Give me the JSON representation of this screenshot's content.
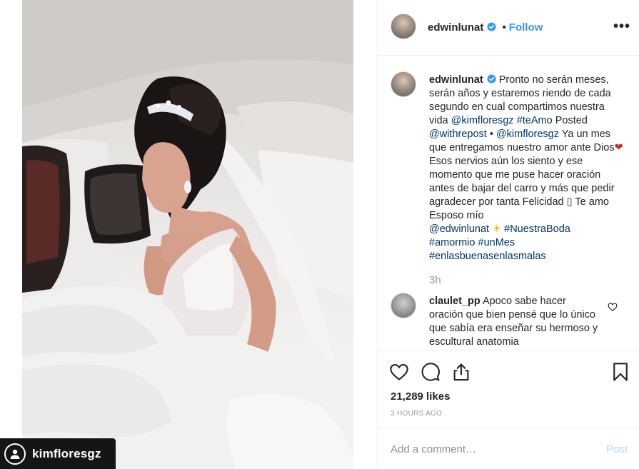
{
  "photo": {
    "overlay_username": "kimfloresgz",
    "repost_icon": "user-icon"
  },
  "header": {
    "username": "edwinlunat",
    "separator": "•",
    "follow_label": "Follow",
    "more_label": "•••",
    "verified_icon": "verified-badge-icon"
  },
  "caption": {
    "username": "edwinlunat",
    "part1": " Pronto no serán meses, serán años y estaremos riendo de cada segundo en cual compartimos nuestra vida ",
    "mention1": "@kimfloresgz",
    "space1": " ",
    "tag1": "#teAmo",
    "part2": " Posted ",
    "mention2": "@withrepost",
    "part3": " • ",
    "mention3": "@kimfloresgz",
    "part4": " Ya un mes que entregamos nuestro amor ante Dios",
    "emoji_heart": "❤",
    "part5": "Esos nervios aún los siento y ese momento que me puse hacer oración antes de bajar del carro y más que pedir agradecer por tanta Felicidad ",
    "emoji_box": "▯",
    "part6": " Te amo Esposo mío ",
    "mention4": "@edwinlunat",
    "emoji_sun": "☀",
    "tag2": "#NuestraBoda",
    "tag3": "#amormio",
    "tag4": "#unMes",
    "tag5": "#enlasbuenasenlasmalas",
    "time": "3h"
  },
  "comment": {
    "username": "claulet_pp",
    "text": " Apoco sabe hacer oración que bien pensé que lo único que sabía era enseñar su hermoso y escultural anatomia"
  },
  "actions": {
    "icons": [
      "heart-icon",
      "comment-icon",
      "share-icon",
      "bookmark-icon"
    ],
    "likes": "21,289 likes",
    "time_ago": "3 HOURS AGO"
  },
  "add_comment": {
    "placeholder": "Add a comment…",
    "post_label": "Post"
  },
  "colors": {
    "link": "#003569",
    "follow": "#3897f0",
    "post_disabled": "#b3dbff",
    "muted": "#999999"
  }
}
